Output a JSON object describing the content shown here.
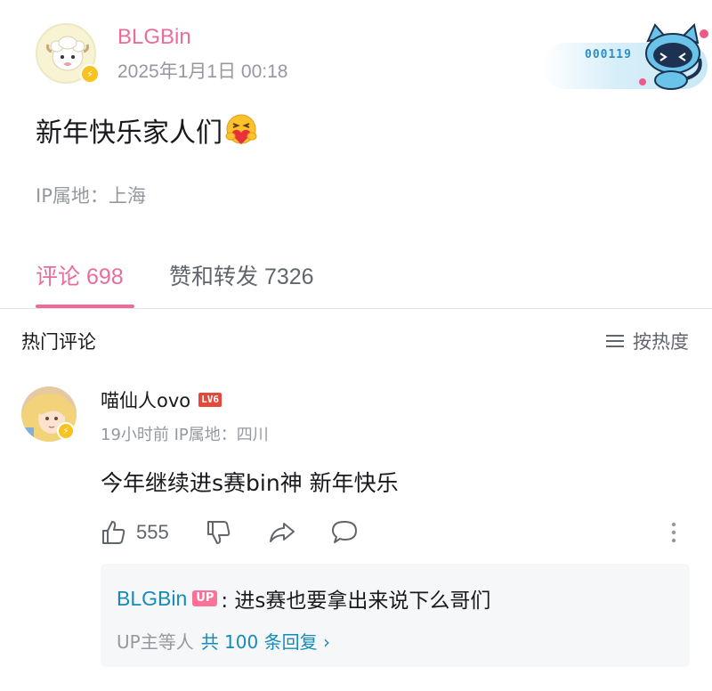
{
  "post": {
    "author": "BLGBin",
    "time": "2025年1月1日 00:18",
    "content": "新年快乐家人们",
    "ip_location": "IP属地：上海",
    "decoration_number": "000119"
  },
  "tabs": [
    {
      "label": "评论 698",
      "active": true
    },
    {
      "label": "赞和转发 7326",
      "active": false
    }
  ],
  "comments_section": {
    "title": "热门评论",
    "sort_label": "按热度"
  },
  "comment": {
    "user": "喵仙人ovo",
    "level": "LV6",
    "meta": "19小时前 IP属地：四川",
    "text": "今年继续进s赛bin神 新年快乐",
    "like_count": "555"
  },
  "reply": {
    "user": "BLGBin",
    "badge": "UP",
    "text": ": 进s赛也要拿出来说下么哥们",
    "summary_prefix": "UP主等人",
    "summary_link": "共 100 条回复 ›"
  },
  "colors": {
    "accent": "#e96d9b",
    "link": "#178bb8",
    "muted": "#9499a0"
  }
}
